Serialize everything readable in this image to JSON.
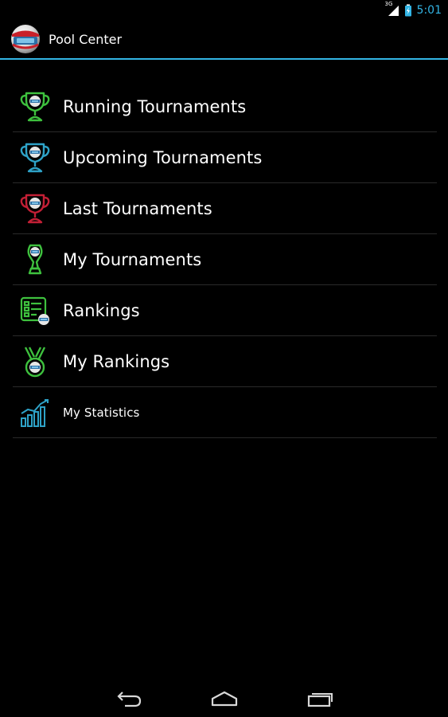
{
  "status_bar": {
    "time": "5:01",
    "network": "3G",
    "icons": [
      "signal-icon",
      "battery-icon"
    ],
    "accent_color": "#33b5e5"
  },
  "action_bar": {
    "title": "Pool Center",
    "icon": "pool-ball-icon",
    "divider_color": "#33b5e5"
  },
  "menu": {
    "items": [
      {
        "label": "Running Tournaments",
        "icon": "trophy-icon",
        "icon_color": "#3ec13e"
      },
      {
        "label": "Upcoming Tournaments",
        "icon": "trophy-icon",
        "icon_color": "#2ea2c7"
      },
      {
        "label": "Last Tournaments",
        "icon": "trophy-icon",
        "icon_color": "#c21f35"
      },
      {
        "label": "My Tournaments",
        "icon": "cup-icon",
        "icon_color": "#3ec13e"
      },
      {
        "label": "Rankings",
        "icon": "ranking-board-icon",
        "icon_color": "#3ec13e"
      },
      {
        "label": "My Rankings",
        "icon": "medal-icon",
        "icon_color": "#3ec13e"
      },
      {
        "label": "My Statistics",
        "icon": "statistics-chart-icon",
        "icon_color": "#2ea2c7"
      }
    ]
  },
  "nav_bar": {
    "buttons": [
      "back-icon",
      "home-icon",
      "recent-apps-icon"
    ]
  }
}
